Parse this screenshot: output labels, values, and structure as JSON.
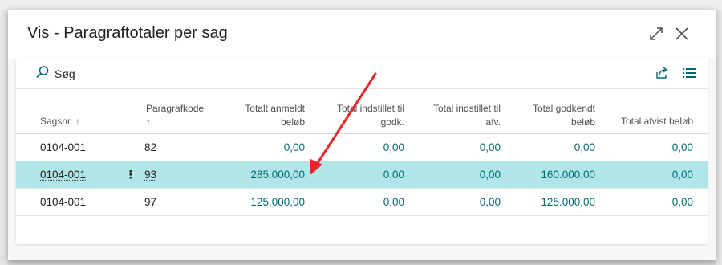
{
  "dialog": {
    "title": "Vis - Paragraftotaler per sag"
  },
  "toolbar": {
    "search_label": "Søg"
  },
  "table": {
    "headers": {
      "sagsnr": "Sagsnr. ↑",
      "paragrafkode_line1": "Paragrafkode",
      "paragrafkode_line2": "↑",
      "anmeldt_line1": "Totalt anmeldt",
      "anmeldt_line2": "beløb",
      "indstillet_godk_line1": "Total indstillet til",
      "indstillet_godk_line2": "godk.",
      "indstillet_afv_line1": "Total indstillet til",
      "indstillet_afv_line2": "afv.",
      "godkendt_line1": "Total godkendt",
      "godkendt_line2": "beløb",
      "afvist": "Total afvist beløb"
    },
    "rows": [
      {
        "sagsnr": "0104-001",
        "paragrafkode": "82",
        "anmeldt": "0,00",
        "indstillet_godk": "0,00",
        "indstillet_afv": "0,00",
        "godkendt": "0,00",
        "afvist": "0,00"
      },
      {
        "sagsnr": "0104-001",
        "paragrafkode": "93",
        "anmeldt": "285.000,00",
        "indstillet_godk": "0,00",
        "indstillet_afv": "0,00",
        "godkendt": "160.000,00",
        "afvist": "0,00"
      },
      {
        "sagsnr": "0104-001",
        "paragrafkode": "97",
        "anmeldt": "125.000,00",
        "indstillet_godk": "0,00",
        "indstillet_afv": "0,00",
        "godkendt": "125.000,00",
        "afvist": "0,00"
      }
    ]
  },
  "icons": {
    "search": "search-icon",
    "share": "share-icon",
    "list_view": "list-view-icon",
    "expand": "expand-icon",
    "close": "close-icon",
    "row_menu": "row-actions-icon"
  },
  "colors": {
    "selected_row": "#b1e6e8",
    "link_value": "#006a72",
    "annotation_arrow": "#e8262a"
  }
}
